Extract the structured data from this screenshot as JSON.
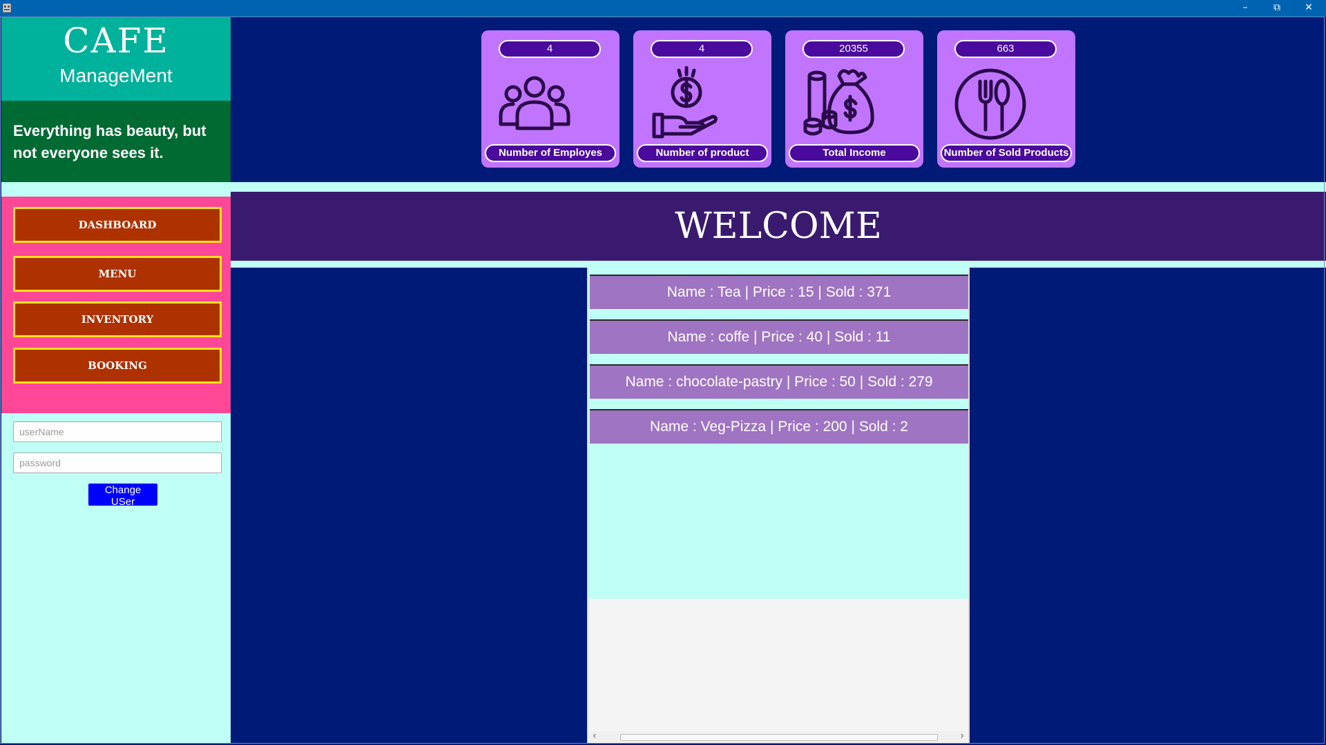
{
  "window": {
    "minimize_glyph": "–",
    "restore_glyph": "⧉",
    "close_glyph": "✕"
  },
  "sidebar": {
    "brand_title": "CAFE",
    "brand_subtitle": "ManageMent",
    "quote": "Everything has beauty, but not everyone sees it.",
    "nav": [
      {
        "label": "DASHBOARD"
      },
      {
        "label": "MENU"
      },
      {
        "label": "INVENTORY"
      },
      {
        "label": "BOOKING"
      }
    ],
    "username_placeholder": "userName",
    "password_placeholder": "password",
    "change_user_label": "Change USer"
  },
  "stats": [
    {
      "value": "4",
      "label": "Number of Employes",
      "icon": "people-icon"
    },
    {
      "value": "4",
      "label": "Number of product",
      "icon": "money-hand-icon"
    },
    {
      "value": "20355",
      "label": "Total Income",
      "icon": "money-bag-icon"
    },
    {
      "value": "663",
      "label": "Number of Sold Products",
      "icon": "plate-cutlery-icon"
    }
  ],
  "welcome": "WELCOME",
  "products": [
    {
      "text": "Name : Tea | Price : 15 | Sold : 371"
    },
    {
      "text": "Name : coffe | Price : 40 | Sold : 11"
    },
    {
      "text": "Name : chocolate-pastry | Price : 50 | Sold : 279"
    },
    {
      "text": "Name : Veg-Pizza | Price : 200 | Sold : 2"
    }
  ],
  "colors": {
    "background": "#001A78",
    "brand": "#00B19B",
    "quote_bg": "#006A33",
    "nav_panel": "#FF4797",
    "nav_button": "#AE3200",
    "nav_border": "#FFE21C",
    "card": "#C175FF",
    "pill": "#4A0A9E",
    "welcome_bg": "#3A1A6E",
    "list_item": "#9F74C2",
    "light_cyan": "#BFFFF5"
  }
}
